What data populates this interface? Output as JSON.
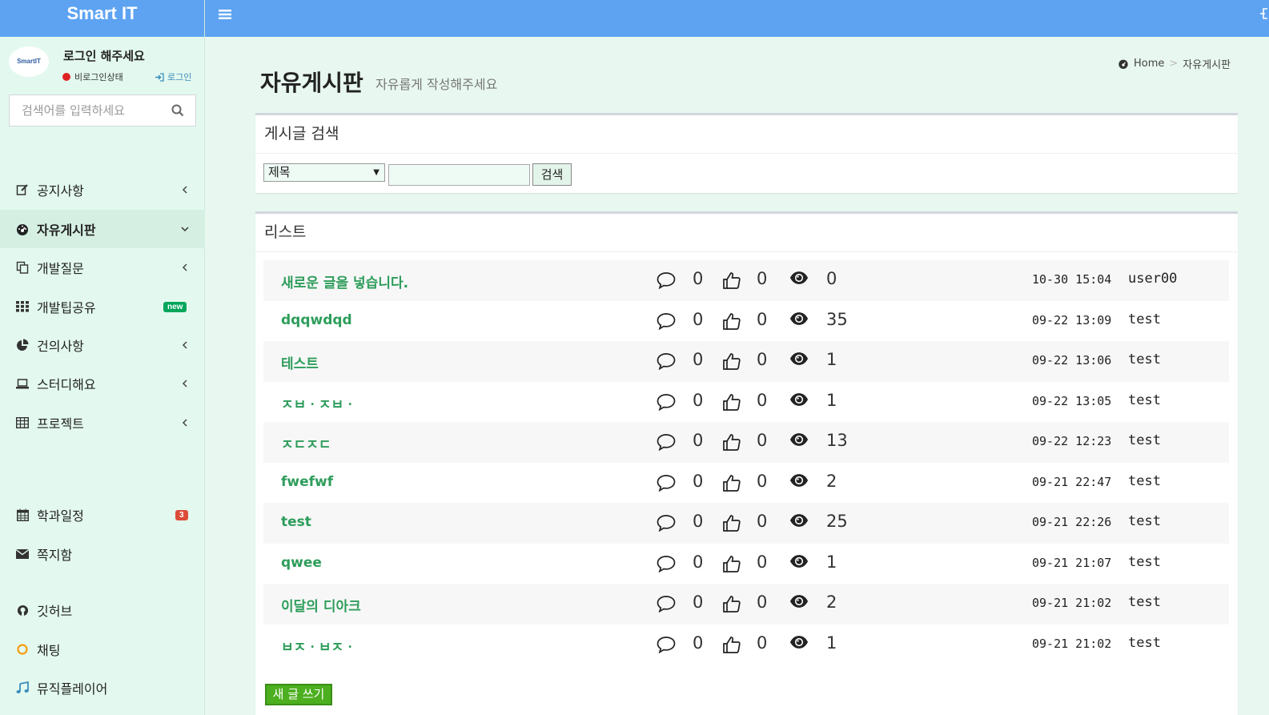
{
  "brand": "Smart IT",
  "avatar_text": "SmartIT",
  "user": {
    "name": "로그인 해주세요",
    "status": "비로그인상태",
    "login_label": "로그인"
  },
  "sidebar_search": {
    "placeholder": "검색어를 입력하세요"
  },
  "menu": [
    {
      "label": "공지사항",
      "icon": "edit-icon"
    },
    {
      "label": "자유게시판",
      "icon": "dashboard-icon"
    },
    {
      "label": "개발질문",
      "icon": "copy-icon"
    },
    {
      "label": "개발팁공유",
      "icon": "grid-icon",
      "badge": "new"
    },
    {
      "label": "건의사항",
      "icon": "pie-chart-icon"
    },
    {
      "label": "스터디해요",
      "icon": "laptop-icon"
    },
    {
      "label": "프로젝트",
      "icon": "table-icon"
    },
    {
      "label": "학과일정",
      "icon": "calendar-icon",
      "badge": "3"
    },
    {
      "label": "쪽지함",
      "icon": "envelope-icon"
    },
    {
      "label": "깃허브",
      "icon": "github-icon"
    },
    {
      "label": "채팅",
      "icon": "circle-icon"
    },
    {
      "label": "뮤직플레이어",
      "icon": "music-icon"
    }
  ],
  "page": {
    "title": "자유게시판",
    "subtitle": "자유롭게 작성해주세요"
  },
  "breadcrumb": {
    "home": "Home",
    "current": "자유게시판"
  },
  "search_box": {
    "title": "게시글 검색",
    "select_value": "제목",
    "button": "검색"
  },
  "list_box": {
    "title": "리스트",
    "write_button": "새 글 쓰기"
  },
  "colors": {
    "topbar": "#5ea3f2",
    "title_green": "#2e9d5b",
    "write_green": "#4caf1f",
    "badge_new": "#00a65a",
    "badge_red": "#dd4b39"
  },
  "posts": [
    {
      "title": "새로운 글을 넣습니다.",
      "comments": "0",
      "likes": "0",
      "views": "0",
      "date": "10-30 15:04",
      "user": "user00"
    },
    {
      "title": "dqqwdqd",
      "comments": "0",
      "likes": "0",
      "views": "35",
      "date": "09-22 13:09",
      "user": "test"
    },
    {
      "title": "테스트",
      "comments": "0",
      "likes": "0",
      "views": "1",
      "date": "09-22 13:06",
      "user": "test"
    },
    {
      "title": "ㅈㅂㆍㅈㅂㆍ",
      "comments": "0",
      "likes": "0",
      "views": "1",
      "date": "09-22 13:05",
      "user": "test"
    },
    {
      "title": "ㅈㄷㅈㄷ",
      "comments": "0",
      "likes": "0",
      "views": "13",
      "date": "09-22 12:23",
      "user": "test"
    },
    {
      "title": "fwefwf",
      "comments": "0",
      "likes": "0",
      "views": "2",
      "date": "09-21 22:47",
      "user": "test"
    },
    {
      "title": "test",
      "comments": "0",
      "likes": "0",
      "views": "25",
      "date": "09-21 22:26",
      "user": "test"
    },
    {
      "title": "qwee",
      "comments": "0",
      "likes": "0",
      "views": "1",
      "date": "09-21 21:07",
      "user": "test"
    },
    {
      "title": "이달의 디아크",
      "comments": "0",
      "likes": "0",
      "views": "2",
      "date": "09-21 21:02",
      "user": "test"
    },
    {
      "title": "ㅂㅈㆍㅂㅈㆍ",
      "comments": "0",
      "likes": "0",
      "views": "1",
      "date": "09-21 21:02",
      "user": "test"
    }
  ]
}
